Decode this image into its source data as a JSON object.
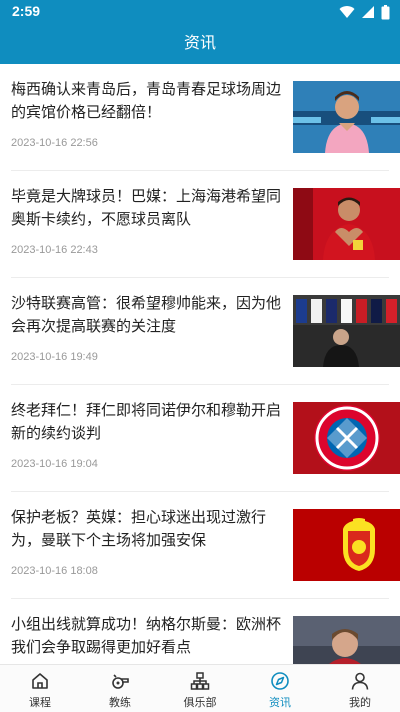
{
  "status": {
    "time": "2:59"
  },
  "header": {
    "title": "资讯"
  },
  "news": [
    {
      "headline": "梅西确认来青岛后，青岛青春足球场周边的宾馆价格已经翻倍！",
      "date": "2023-10-16 22:56",
      "image": "messi-inter-miami-photo"
    },
    {
      "headline": "毕竟是大牌球员！巴媒：上海海港希望同奥斯卡续约，不愿球员离队",
      "date": "2023-10-16 22:43",
      "image": "oscar-heart-gesture-photo"
    },
    {
      "headline": "沙特联赛高管：很希望穆帅能来，因为他会再次提高联赛的关注度",
      "date": "2023-10-16 19:49",
      "image": "mourinho-club-crests-photo"
    },
    {
      "headline": "终老拜仁！拜仁即将同诺伊尔和穆勒开启新的续约谈判",
      "date": "2023-10-16 19:04",
      "image": "fc-bayern-logo"
    },
    {
      "headline": "保护老板？英媒：担心球迷出现过激行为，曼联下个主场将加强安保",
      "date": "2023-10-16 18:08",
      "image": "manchester-united-logo"
    },
    {
      "headline": "小组出线就算成功！纳格尔斯曼：欧洲杯我们会争取踢得更加好看点",
      "date": "",
      "image": "nagelsmann-photo"
    }
  ],
  "tabs": [
    {
      "label": "课程",
      "icon": "home-icon",
      "active": false
    },
    {
      "label": "教练",
      "icon": "whistle-icon",
      "active": false
    },
    {
      "label": "俱乐部",
      "icon": "org-chart-icon",
      "active": false
    },
    {
      "label": "资讯",
      "icon": "compass-icon",
      "active": true
    },
    {
      "label": "我的",
      "icon": "person-icon",
      "active": false
    }
  ],
  "colors": {
    "primary": "#0f8dbf",
    "tab_inactive": "#333333",
    "date": "#999999"
  }
}
